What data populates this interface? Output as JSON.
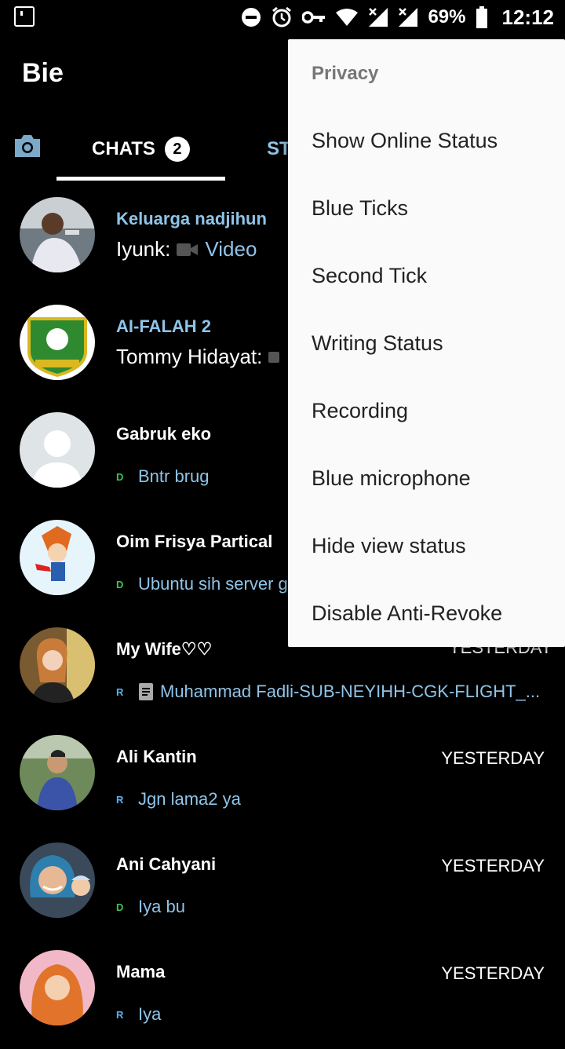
{
  "status_bar": {
    "battery": "69%",
    "time": "12:12"
  },
  "app": {
    "title": "Bie"
  },
  "tabs": {
    "chats_label": "CHATS",
    "chats_badge": "2",
    "status_label_partial": "ST"
  },
  "chats": [
    {
      "name": "Keluarga nadjihun",
      "sender": "Iyunk:",
      "message": "Video",
      "time": ""
    },
    {
      "name": "AI-FALAH 2",
      "sender": "Tommy Hidayat:",
      "message": "",
      "time": ""
    },
    {
      "name": "Gabruk eko",
      "tick": "D",
      "message": "Bntr brug",
      "time": ""
    },
    {
      "name": "Oim Frisya Partical",
      "tick": "D",
      "message": "Ubuntu sih server g",
      "time": ""
    },
    {
      "name": "My Wife♡♡",
      "tick": "R",
      "message": "Muhammad Fadli-SUB-NEYIHH-CGK-FLIGHT_...",
      "time": "YESTERDAY"
    },
    {
      "name": "Ali Kantin",
      "tick": "R",
      "message": "Jgn lama2 ya",
      "time": "YESTERDAY"
    },
    {
      "name": "Ani Cahyani",
      "tick": "D",
      "message": "Iya bu",
      "time": "YESTERDAY"
    },
    {
      "name": "Mama",
      "tick": "R",
      "message": "Iya",
      "time": "YESTERDAY"
    }
  ],
  "menu": {
    "header": "Privacy",
    "items": [
      "Show Online Status",
      "Blue Ticks",
      "Second Tick",
      "Writing Status",
      "Recording",
      "Blue microphone",
      "Hide view status",
      "Disable Anti-Revoke"
    ]
  },
  "colors": {
    "background": "#000000",
    "accent_blue": "#8fc4e8",
    "tick_d": "#3cc35a",
    "tick_r": "#5ab0ee",
    "menu_bg": "#fafafa"
  }
}
